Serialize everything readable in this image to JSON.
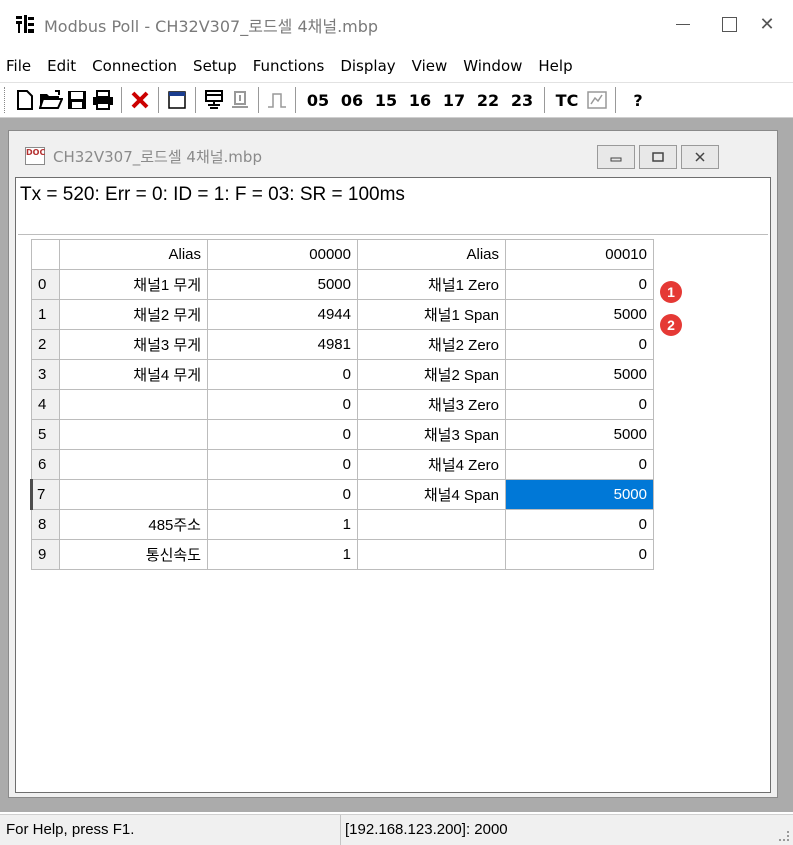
{
  "window": {
    "title": "Modbus Poll - CH32V307_로드셀 4채널.mbp",
    "app_icon": "modbus-poll-icon",
    "min_glyph": "",
    "max_glyph": "",
    "close_glyph": "✕"
  },
  "menu": [
    "File",
    "Edit",
    "Connection",
    "Setup",
    "Functions",
    "Display",
    "View",
    "Window",
    "Help"
  ],
  "toolbar": {
    "function_codes": [
      "05",
      "06",
      "15",
      "16",
      "17",
      "22",
      "23"
    ],
    "tc_label": "TC",
    "help_glyph": "?"
  },
  "child": {
    "title": "CH32V307_로드셀 4채널.mbp",
    "doc_icon_text": "DOC",
    "status_line": "Tx = 520: Err = 0: ID = 1: F = 03: SR = 100ms"
  },
  "grid": {
    "headers": [
      "Alias",
      "00000",
      "Alias",
      "00010"
    ],
    "rows": [
      {
        "n": "0",
        "alias1": "채널1 무게",
        "val1": "5000",
        "alias2": "채널1 Zero",
        "val2": "0"
      },
      {
        "n": "1",
        "alias1": "채널2 무게",
        "val1": "4944",
        "alias2": "채널1 Span",
        "val2": "5000"
      },
      {
        "n": "2",
        "alias1": "채널3 무게",
        "val1": "4981",
        "alias2": "채널2 Zero",
        "val2": "0"
      },
      {
        "n": "3",
        "alias1": "채널4 무게",
        "val1": "0",
        "alias2": "채널2 Span",
        "val2": "5000"
      },
      {
        "n": "4",
        "alias1": "",
        "val1": "0",
        "alias2": "채널3 Zero",
        "val2": "0"
      },
      {
        "n": "5",
        "alias1": "",
        "val1": "0",
        "alias2": "채널3 Span",
        "val2": "5000"
      },
      {
        "n": "6",
        "alias1": "",
        "val1": "0",
        "alias2": "채널4 Zero",
        "val2": "0"
      },
      {
        "n": "7",
        "alias1": "",
        "val1": "0",
        "alias2": "채널4 Span",
        "val2": "5000"
      },
      {
        "n": "8",
        "alias1": "485주소",
        "val1": "1",
        "alias2": "",
        "val2": "0"
      },
      {
        "n": "9",
        "alias1": "통신속도",
        "val1": "1",
        "alias2": "",
        "val2": "0"
      }
    ],
    "selected_row": 7
  },
  "annotations": [
    "1",
    "2"
  ],
  "annotation_color": "#e53935",
  "selection_color": "#0078d7",
  "statusbar": {
    "help": "For Help, press F1.",
    "connection": "[192.168.123.200]: 2000"
  }
}
